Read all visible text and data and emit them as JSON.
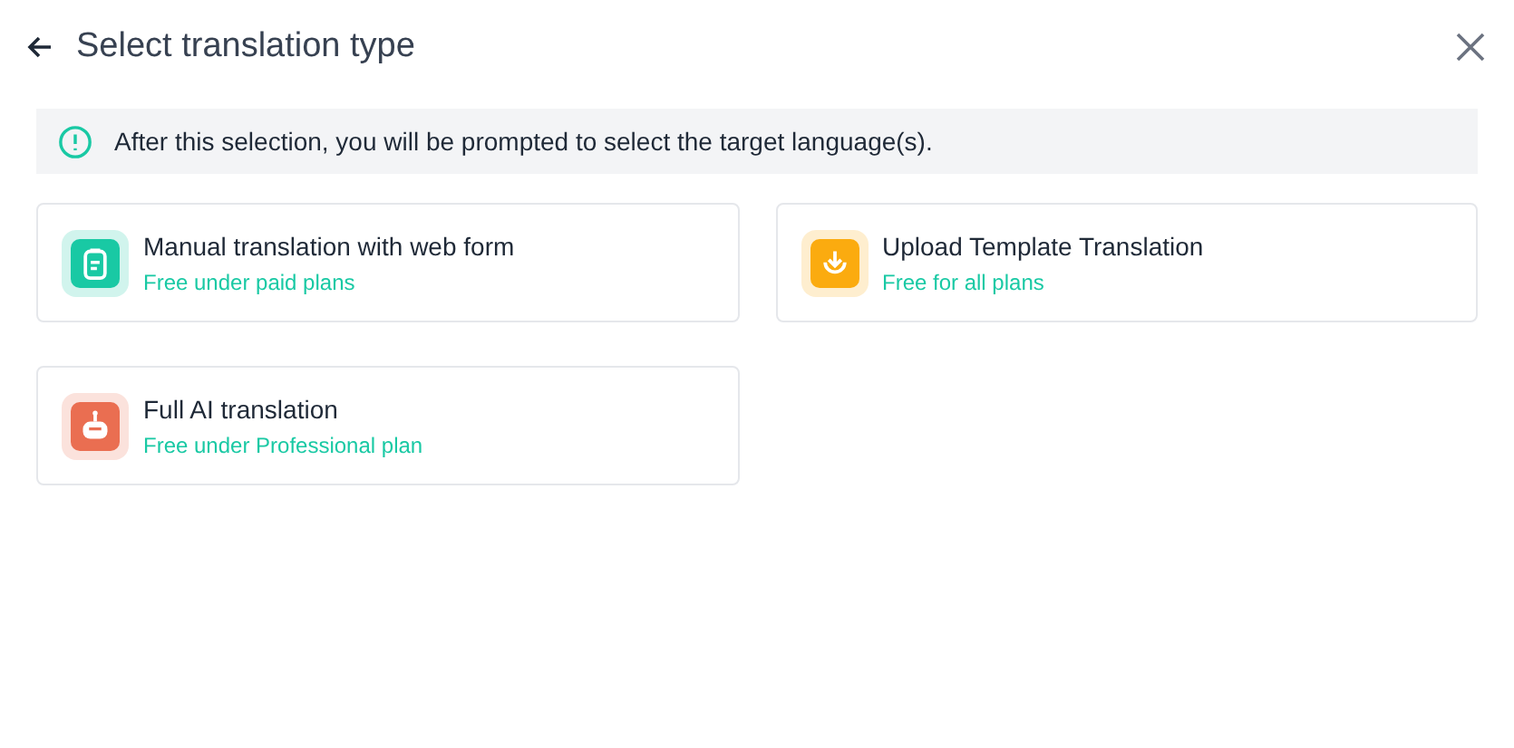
{
  "header": {
    "title": "Select translation type"
  },
  "notice": {
    "text": "After this selection, you will be prompted to select the target language(s)."
  },
  "options": [
    {
      "kind": "form",
      "color": "#19c9a4",
      "title": "Manual translation with web form",
      "subtitle": "Free under paid plans"
    },
    {
      "kind": "upload",
      "color": "#fbab0f",
      "title": "Upload Template Translation",
      "subtitle": "Free for all plans"
    },
    {
      "kind": "ai",
      "color": "#ea6e51",
      "title": "Full AI translation",
      "subtitle": "Free under Professional plan"
    }
  ]
}
